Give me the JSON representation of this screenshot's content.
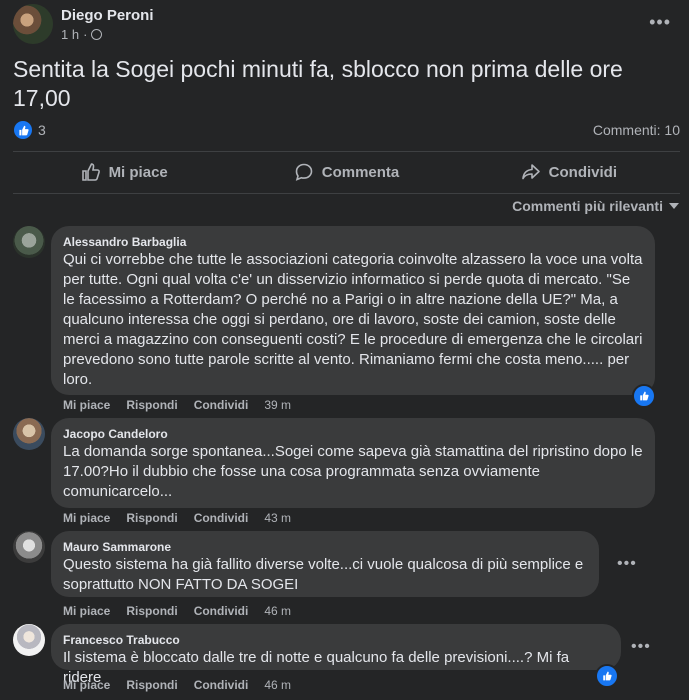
{
  "post": {
    "author": "Diego Peroni",
    "time": "1 h",
    "text": "Sentita la Sogei pochi minuti fa, sblocco non prima delle ore 17,00",
    "reaction_count": "3",
    "comments_label": "Commenti: 10"
  },
  "actions": {
    "like": "Mi piace",
    "comment": "Commenta",
    "share": "Condividi"
  },
  "sort_label": "Commenti più rilevanti",
  "comment_actions": {
    "like": "Mi piace",
    "reply": "Rispondi",
    "share": "Condividi"
  },
  "comments": [
    {
      "name": "Alessandro Barbaglia",
      "text": "Qui ci vorrebbe che tutte le associazioni categoria coinvolte alzassero la voce una volta per tutte. Ogni qual volta c'e' un disservizio informatico si perde quota di mercato. \"Se le facessimo a Rotterdam? O perché no a Parigi o in altre nazione della UE?\" Ma, a qualcuno interessa che oggi si perdano, ore di lavoro, soste dei camion, soste delle merci a magazzino con conseguenti costi? E le procedure di emergenza che le circolari prevedono sono tutte parole scritte al vento. Rimaniamo fermi che costa meno..... per loro.",
      "time": "39 m"
    },
    {
      "name": "Jacopo Candeloro",
      "text": "La domanda sorge spontanea...Sogei come sapeva già stamattina del ripristino dopo le 17.00?Ho il dubbio che fosse una cosa programmata senza ovviamente comunicarcelo...",
      "time": "43 m"
    },
    {
      "name": "Mauro Sammarone",
      "text": "Questo sistema ha già fallito diverse volte...ci vuole qualcosa di più semplice e soprattutto NON FATTO DA SOGEI",
      "time": "46 m"
    },
    {
      "name": "Francesco Trabucco",
      "text": "Il sistema è bloccato dalle tre di notte e qualcuno fa delle previsioni....? Mi fa ridere",
      "time": "46 m"
    }
  ]
}
